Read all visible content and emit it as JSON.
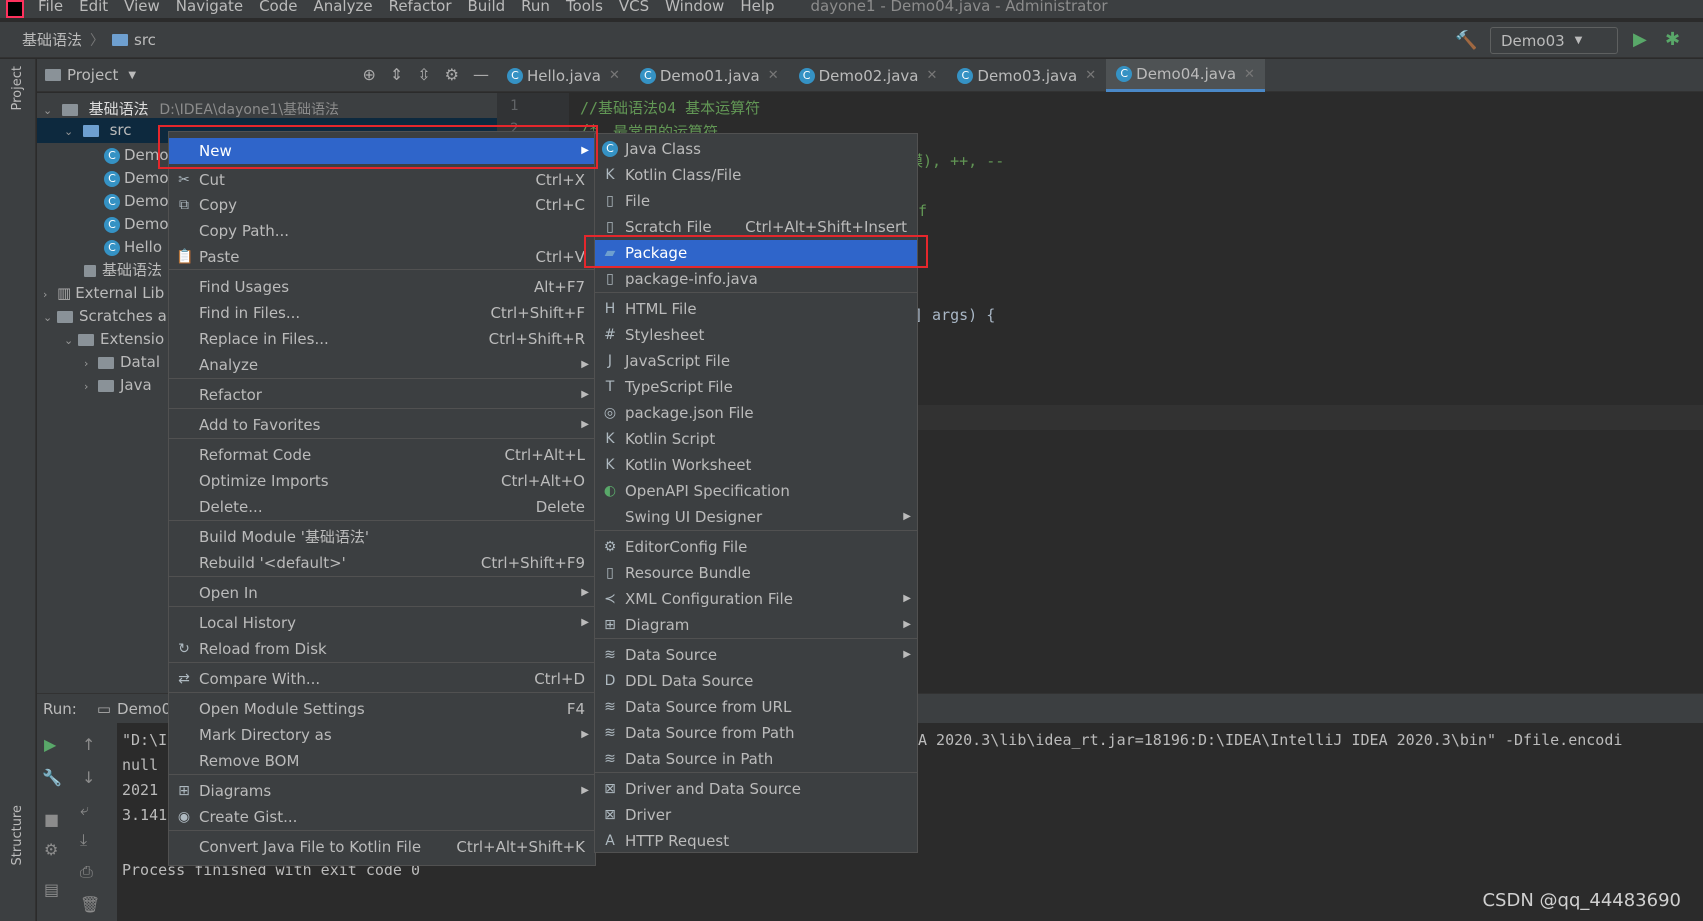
{
  "menubar": {
    "items": [
      "File",
      "Edit",
      "View",
      "Navigate",
      "Code",
      "Analyze",
      "Refactor",
      "Build",
      "Run",
      "Tools",
      "VCS",
      "Window",
      "Help"
    ],
    "title": "dayone1 - Demo04.java - Administrator"
  },
  "navbar": {
    "crumb1": "基础语法",
    "crumb2": "src",
    "run_config": "Demo03"
  },
  "side": {
    "project": "Project",
    "structure": "Structure"
  },
  "project": {
    "header": "Project",
    "root_name": "基础语法",
    "root_path": "D:\\IDEA\\dayone1\\基础语法",
    "src": "src",
    "files": [
      "Demo",
      "Demo",
      "Demo",
      "Demo",
      "Hello"
    ],
    "iml": "基础语法",
    "external": "External Lib",
    "scratches": "Scratches a",
    "extensions": "Extensio",
    "datal": "Datal",
    "java": "Java"
  },
  "editor": {
    "tabs": [
      "Hello.java",
      "Demo01.java",
      "Demo02.java",
      "Demo03.java",
      "Demo04.java"
    ],
    "active_tab": "Demo04.java",
    "line_numbers": [
      "1",
      "2"
    ],
    "code_line1": "//基础语法04 基本运算符",
    "code_line2": "/*",
    "code_line3": "最常用的运算符",
    "frag1": "模), ++, --",
    "frag2": "f",
    "frag3": "] args) {"
  },
  "run": {
    "label": "Run:",
    "tab": "Demo0",
    "lines": [
      "\"D:\\I",
      "null",
      "2021",
      "3.141"
    ],
    "long_line": "A 2020.3\\lib\\idea_rt.jar=18196:D:\\IDEA\\IntelliJ IDEA 2020.3\\bin\" -Dfile.encodi",
    "exit": "Process finished with exit code 0"
  },
  "context_menu": [
    {
      "label": "New",
      "shortcut": "",
      "sub": true,
      "icon": ""
    },
    {
      "label": "Cut",
      "shortcut": "Ctrl+X",
      "sub": false,
      "icon": "scissors-icon"
    },
    {
      "label": "Copy",
      "shortcut": "Ctrl+C",
      "sub": false,
      "icon": "copy-icon"
    },
    {
      "label": "Copy Path...",
      "shortcut": "",
      "sub": false,
      "icon": ""
    },
    {
      "label": "Paste",
      "shortcut": "Ctrl+V",
      "sub": false,
      "icon": "paste-icon"
    },
    {
      "label": "Find Usages",
      "shortcut": "Alt+F7",
      "sub": false,
      "icon": ""
    },
    {
      "label": "Find in Files...",
      "shortcut": "Ctrl+Shift+F",
      "sub": false,
      "icon": ""
    },
    {
      "label": "Replace in Files...",
      "shortcut": "Ctrl+Shift+R",
      "sub": false,
      "icon": ""
    },
    {
      "label": "Analyze",
      "shortcut": "",
      "sub": true,
      "icon": ""
    },
    {
      "label": "Refactor",
      "shortcut": "",
      "sub": true,
      "icon": ""
    },
    {
      "label": "Add to Favorites",
      "shortcut": "",
      "sub": true,
      "icon": ""
    },
    {
      "label": "Reformat Code",
      "shortcut": "Ctrl+Alt+L",
      "sub": false,
      "icon": ""
    },
    {
      "label": "Optimize Imports",
      "shortcut": "Ctrl+Alt+O",
      "sub": false,
      "icon": ""
    },
    {
      "label": "Delete...",
      "shortcut": "Delete",
      "sub": false,
      "icon": ""
    },
    {
      "label": "Build Module '基础语法'",
      "shortcut": "",
      "sub": false,
      "icon": ""
    },
    {
      "label": "Rebuild '<default>'",
      "shortcut": "Ctrl+Shift+F9",
      "sub": false,
      "icon": ""
    },
    {
      "label": "Open In",
      "shortcut": "",
      "sub": true,
      "icon": ""
    },
    {
      "label": "Local History",
      "shortcut": "",
      "sub": true,
      "icon": ""
    },
    {
      "label": "Reload from Disk",
      "shortcut": "",
      "sub": false,
      "icon": "reload-icon"
    },
    {
      "label": "Compare With...",
      "shortcut": "Ctrl+D",
      "sub": false,
      "icon": "compare-icon"
    },
    {
      "label": "Open Module Settings",
      "shortcut": "F4",
      "sub": false,
      "icon": ""
    },
    {
      "label": "Mark Directory as",
      "shortcut": "",
      "sub": true,
      "icon": ""
    },
    {
      "label": "Remove BOM",
      "shortcut": "",
      "sub": false,
      "icon": ""
    },
    {
      "label": "Diagrams",
      "shortcut": "",
      "sub": true,
      "icon": "diagram-icon"
    },
    {
      "label": "Create Gist...",
      "shortcut": "",
      "sub": false,
      "icon": "github-icon"
    },
    {
      "label": "Convert Java File to Kotlin File",
      "shortcut": "Ctrl+Alt+Shift+K",
      "sub": false,
      "icon": ""
    }
  ],
  "new_submenu": [
    {
      "label": "Java Class",
      "shortcut": "",
      "sub": false,
      "icon": "java-class-icon"
    },
    {
      "label": "Kotlin Class/File",
      "shortcut": "",
      "sub": false,
      "icon": "kotlin-icon"
    },
    {
      "label": "File",
      "shortcut": "",
      "sub": false,
      "icon": "file-icon"
    },
    {
      "label": "Scratch File",
      "shortcut": "Ctrl+Alt+Shift+Insert",
      "sub": false,
      "icon": "scratch-icon"
    },
    {
      "label": "Package",
      "shortcut": "",
      "sub": false,
      "icon": "package-icon"
    },
    {
      "label": "package-info.java",
      "shortcut": "",
      "sub": false,
      "icon": "java-file-icon"
    },
    {
      "label": "HTML File",
      "shortcut": "",
      "sub": false,
      "icon": "html-icon"
    },
    {
      "label": "Stylesheet",
      "shortcut": "",
      "sub": false,
      "icon": "css-icon"
    },
    {
      "label": "JavaScript File",
      "shortcut": "",
      "sub": false,
      "icon": "js-icon"
    },
    {
      "label": "TypeScript File",
      "shortcut": "",
      "sub": false,
      "icon": "ts-icon"
    },
    {
      "label": "package.json File",
      "shortcut": "",
      "sub": false,
      "icon": "npm-icon"
    },
    {
      "label": "Kotlin Script",
      "shortcut": "",
      "sub": false,
      "icon": "kotlin-icon"
    },
    {
      "label": "Kotlin Worksheet",
      "shortcut": "",
      "sub": false,
      "icon": "kotlin-icon"
    },
    {
      "label": "OpenAPI Specification",
      "shortcut": "",
      "sub": false,
      "icon": "openapi-icon"
    },
    {
      "label": "Swing UI Designer",
      "shortcut": "",
      "sub": true,
      "icon": ""
    },
    {
      "label": "EditorConfig File",
      "shortcut": "",
      "sub": false,
      "icon": "gear-icon"
    },
    {
      "label": "Resource Bundle",
      "shortcut": "",
      "sub": false,
      "icon": "file-icon"
    },
    {
      "label": "XML Configuration File",
      "shortcut": "",
      "sub": true,
      "icon": "xml-icon"
    },
    {
      "label": "Diagram",
      "shortcut": "",
      "sub": true,
      "icon": "diagram-icon"
    },
    {
      "label": "Data Source",
      "shortcut": "",
      "sub": true,
      "icon": "database-icon"
    },
    {
      "label": "DDL Data Source",
      "shortcut": "",
      "sub": false,
      "icon": "ddl-icon"
    },
    {
      "label": "Data Source from URL",
      "shortcut": "",
      "sub": false,
      "icon": "database-icon"
    },
    {
      "label": "Data Source from Path",
      "shortcut": "",
      "sub": false,
      "icon": "database-icon"
    },
    {
      "label": "Data Source in Path",
      "shortcut": "",
      "sub": false,
      "icon": "database-icon"
    },
    {
      "label": "Driver and Data Source",
      "shortcut": "",
      "sub": false,
      "icon": "driver-icon"
    },
    {
      "label": "Driver",
      "shortcut": "",
      "sub": false,
      "icon": "driver-icon"
    },
    {
      "label": "HTTP Request",
      "shortcut": "",
      "sub": false,
      "icon": "api-icon"
    }
  ],
  "watermark": "CSDN @qq_44483690",
  "colors": {
    "highlight": "#2f65ca",
    "callout": "#e5272c",
    "accent_green": "#59a869"
  }
}
